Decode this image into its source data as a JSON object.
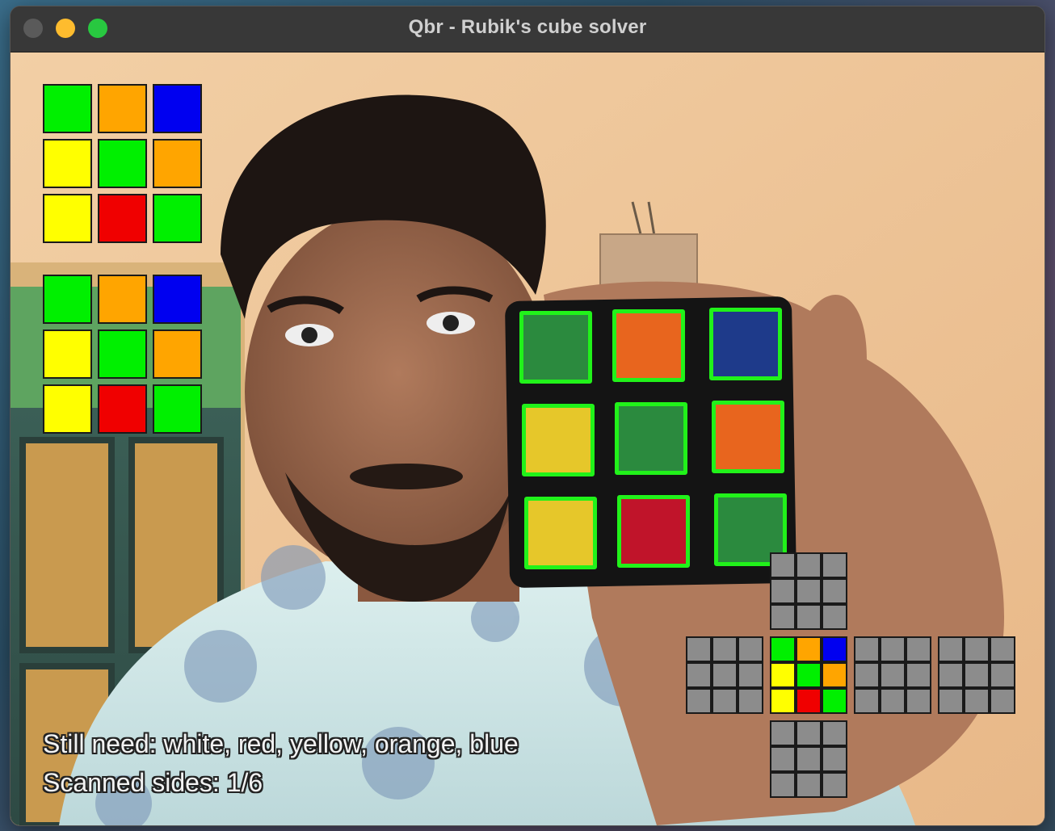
{
  "window": {
    "title": "Qbr - Rubik's cube solver",
    "traffic_lights": [
      "close",
      "minimize",
      "maximize"
    ]
  },
  "colors": {
    "green": "#00f000",
    "orange": "#ffa500",
    "blue": "#0000f0",
    "yellow": "#ffff00",
    "red": "#f00000",
    "white": "#ffffff",
    "empty": "#8c8c8c",
    "detection_outline": "#21f21a"
  },
  "preview_current": [
    [
      "green",
      "orange",
      "blue"
    ],
    [
      "yellow",
      "green",
      "orange"
    ],
    [
      "yellow",
      "red",
      "green"
    ]
  ],
  "preview_snapshot": [
    [
      "green",
      "orange",
      "blue"
    ],
    [
      "yellow",
      "green",
      "orange"
    ],
    [
      "yellow",
      "red",
      "green"
    ]
  ],
  "cube_stickers_detected": [
    [
      "green",
      "orange",
      "blue"
    ],
    [
      "yellow",
      "green",
      "orange"
    ],
    [
      "yellow",
      "red",
      "green"
    ]
  ],
  "cube_map": {
    "up": [
      [
        "empty",
        "empty",
        "empty"
      ],
      [
        "empty",
        "empty",
        "empty"
      ],
      [
        "empty",
        "empty",
        "empty"
      ]
    ],
    "left": [
      [
        "empty",
        "empty",
        "empty"
      ],
      [
        "empty",
        "empty",
        "empty"
      ],
      [
        "empty",
        "empty",
        "empty"
      ]
    ],
    "front": [
      [
        "green",
        "orange",
        "blue"
      ],
      [
        "yellow",
        "green",
        "orange"
      ],
      [
        "yellow",
        "red",
        "green"
      ]
    ],
    "right": [
      [
        "empty",
        "empty",
        "empty"
      ],
      [
        "empty",
        "empty",
        "empty"
      ],
      [
        "empty",
        "empty",
        "empty"
      ]
    ],
    "back": [
      [
        "empty",
        "empty",
        "empty"
      ],
      [
        "empty",
        "empty",
        "empty"
      ],
      [
        "empty",
        "empty",
        "empty"
      ]
    ],
    "down": [
      [
        "empty",
        "empty",
        "empty"
      ],
      [
        "empty",
        "empty",
        "empty"
      ],
      [
        "empty",
        "empty",
        "empty"
      ]
    ]
  },
  "status": {
    "still_need": "Still need: white, red, yellow, orange, blue",
    "scanned_sides": "Scanned sides: 1/6"
  }
}
